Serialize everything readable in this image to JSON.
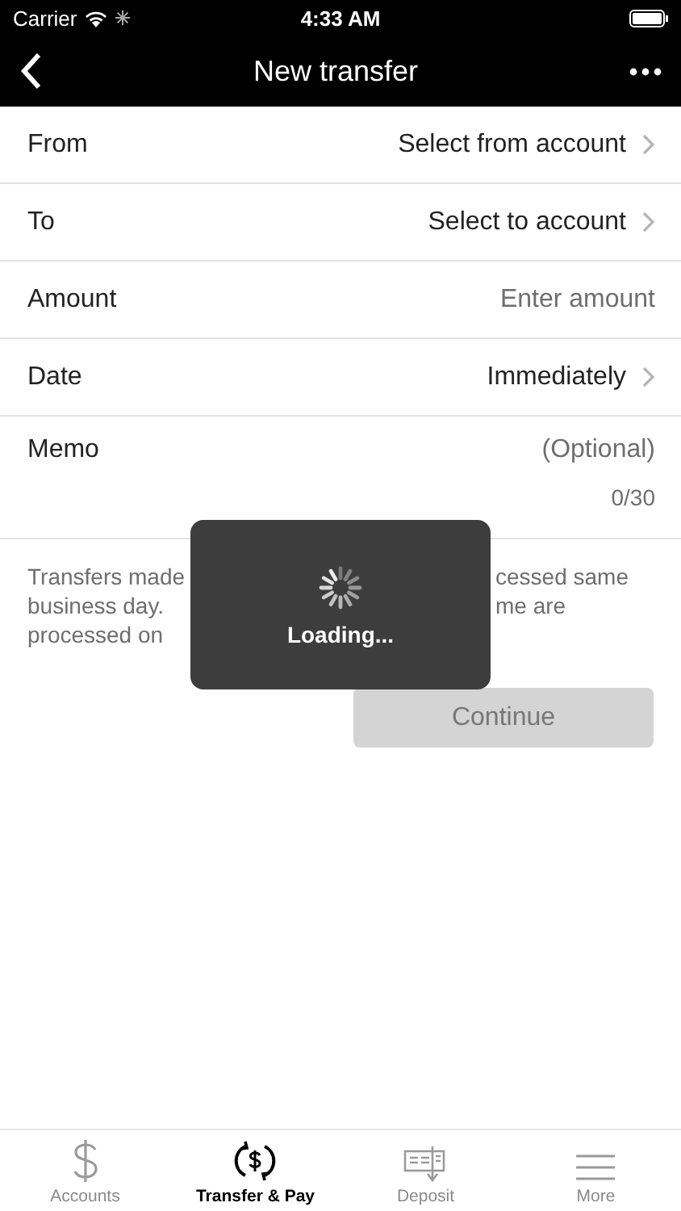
{
  "status_bar": {
    "carrier": "Carrier",
    "time": "4:33 AM"
  },
  "nav": {
    "title": "New transfer"
  },
  "fields": [
    {
      "label": "From",
      "value": "Select from account",
      "kind": "picker"
    },
    {
      "label": "To",
      "value": "Select to account",
      "kind": "picker"
    },
    {
      "label": "Amount",
      "placeholder": "Enter amount",
      "kind": "input"
    },
    {
      "label": "Date",
      "value": "Immediately",
      "kind": "picker"
    },
    {
      "label": "Memo",
      "placeholder": "(Optional)",
      "counter": "0/30",
      "kind": "memo"
    }
  ],
  "notice_lines": [
    {
      "left": "Transfers made",
      "right": "cessed same"
    },
    {
      "left": "business day.",
      "right": "me are"
    },
    {
      "left": "processed on"
    }
  ],
  "continue_button": {
    "label": "Continue",
    "disabled": true
  },
  "loading": {
    "label": "Loading..."
  },
  "tabs": [
    {
      "label": "Accounts",
      "selected": false
    },
    {
      "label": "Transfer & Pay",
      "selected": true
    },
    {
      "label": "Deposit",
      "selected": false
    },
    {
      "label": "More",
      "selected": false
    }
  ]
}
